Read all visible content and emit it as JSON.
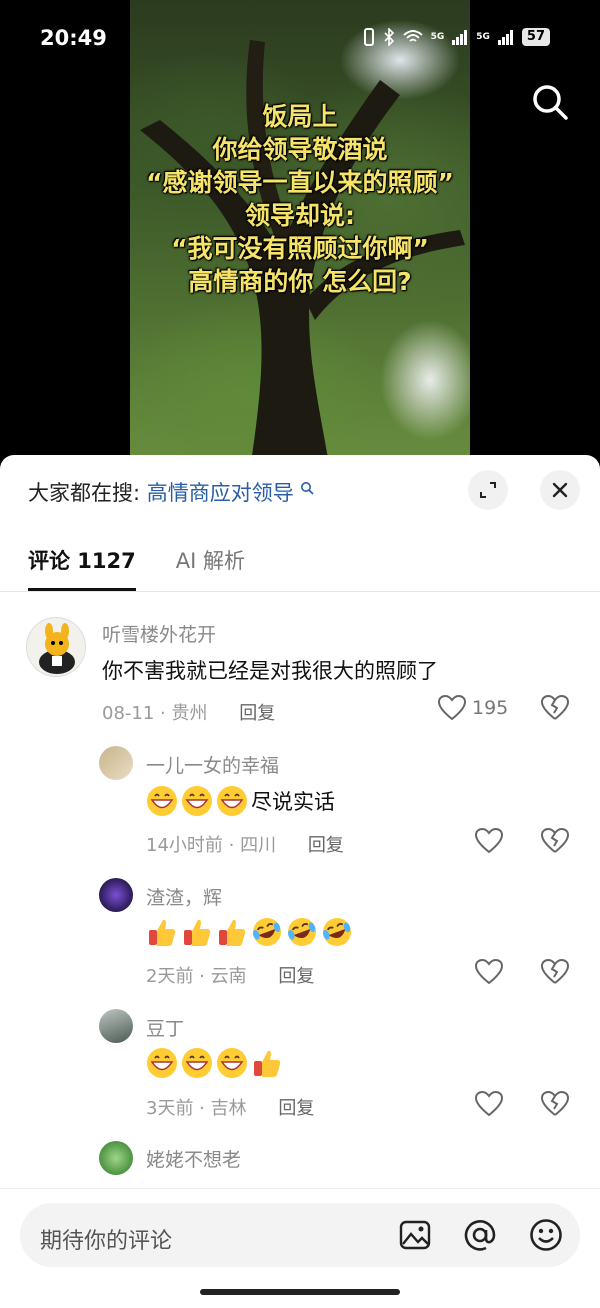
{
  "status_bar": {
    "time": "20:49",
    "signal_1": "5G",
    "signal_2": "5G",
    "battery": "57"
  },
  "video": {
    "caption_lines": [
      "饭局上",
      "你给领导敬酒说",
      "“感谢领导一直以来的照顾”",
      "领导却说:",
      "“我可没有照顾过你啊”",
      "高情商的你 怎么回?"
    ],
    "search_icon": "search-icon"
  },
  "sheet": {
    "search_prefix": "大家都在搜:",
    "search_keyword": "高情商应对领导",
    "expand_icon": "expand-icon",
    "close_icon": "close-icon",
    "tabs": [
      {
        "label": "评论 1127",
        "active": true
      },
      {
        "label": "AI 解析",
        "active": false
      }
    ]
  },
  "comments": [
    {
      "name": "听雪楼外花开",
      "text": "你不害我就已经是对我很大的照顾了",
      "date": "08-11",
      "location": "贵州",
      "reply_label": "回复",
      "like_count": "195",
      "avatar": "kangaroo-avatar"
    },
    {
      "name": "一儿一女的幸福",
      "text": "尽说实话",
      "emojis": [
        "grin-emoji",
        "grin-emoji",
        "grin-emoji"
      ],
      "date": "14小时前",
      "location": "四川",
      "reply_label": "回复",
      "avatar": "child-avatar"
    },
    {
      "name": "渣渣，辉",
      "text": "",
      "emojis": [
        "thumbs-up-emoji",
        "thumbs-up-emoji",
        "thumbs-up-emoji",
        "laugh-cry-emoji",
        "laugh-cry-emoji",
        "laugh-cry-emoji"
      ],
      "date": "2天前",
      "location": "云南",
      "reply_label": "回复",
      "avatar": "purple-avatar"
    },
    {
      "name": "豆丁",
      "text": "",
      "emojis": [
        "grin-emoji",
        "grin-emoji",
        "grin-emoji",
        "thumbs-up-emoji"
      ],
      "date": "3天前",
      "location": "吉林",
      "reply_label": "回复",
      "avatar": "photo-avatar"
    },
    {
      "name": "姥姥不想老",
      "text": "",
      "avatar": "green-avatar"
    }
  ],
  "composer": {
    "placeholder": "期待你的评论",
    "image_icon": "image-icon",
    "mention_icon": "at-icon",
    "emoji_icon": "smile-icon"
  },
  "colors": {
    "caption": "#f5e36a",
    "keyword": "#2a5da8",
    "meta": "#9a9a9a"
  }
}
